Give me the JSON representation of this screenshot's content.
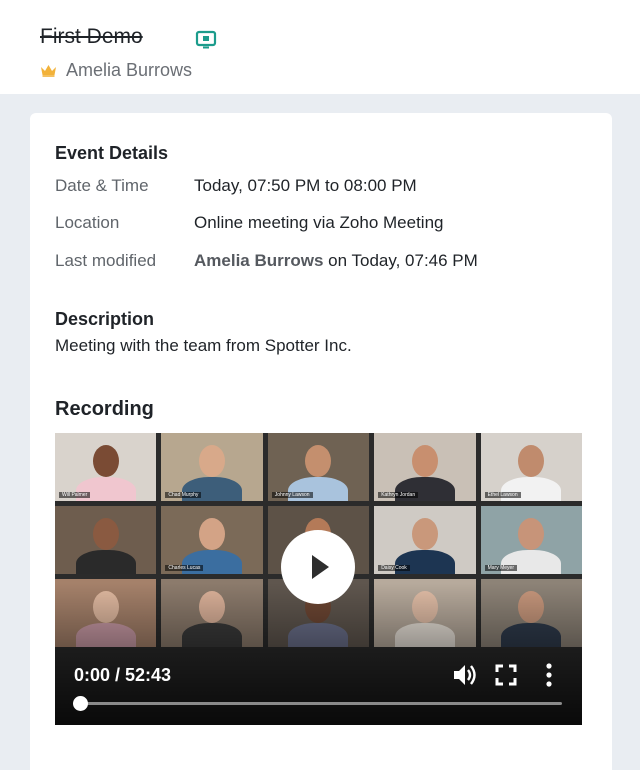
{
  "header": {
    "title": "First Demo",
    "owner": "Amelia Burrows",
    "crown_color": "#f2b23a",
    "meeting_icon_color": "#1c9c8c"
  },
  "event_details": {
    "heading": "Event Details",
    "rows": [
      {
        "label": "Date & Time",
        "value": "Today, 07:50 PM to 08:00 PM"
      },
      {
        "label": "Location",
        "value": "Online meeting via Zoho Meeting"
      },
      {
        "label": "Last modified",
        "modified_by": "Amelia Burrows",
        "value": "on Today, 07:46 PM"
      }
    ]
  },
  "description": {
    "heading": "Description",
    "text": "Meeting with the team from Spotter Inc."
  },
  "recording": {
    "heading": "Recording",
    "time_readout": "0:00 / 52:43",
    "progress": 0,
    "controls": [
      "play-icon",
      "volume-icon",
      "fullscreen-icon",
      "more-vertical-icon"
    ],
    "participants": [
      {
        "name": "Will Palmer"
      },
      {
        "name": "Chad Murphy"
      },
      {
        "name": "Johnny Lawson"
      },
      {
        "name": "Kathryn Jordan"
      },
      {
        "name": "Ethel Lawson"
      },
      {
        "name": ""
      },
      {
        "name": "Charles Lucas"
      },
      {
        "name": ""
      },
      {
        "name": "Daisy Cook"
      },
      {
        "name": "Mary Meyer"
      },
      {
        "name": ""
      },
      {
        "name": ""
      },
      {
        "name": ""
      },
      {
        "name": ""
      },
      {
        "name": ""
      }
    ]
  }
}
